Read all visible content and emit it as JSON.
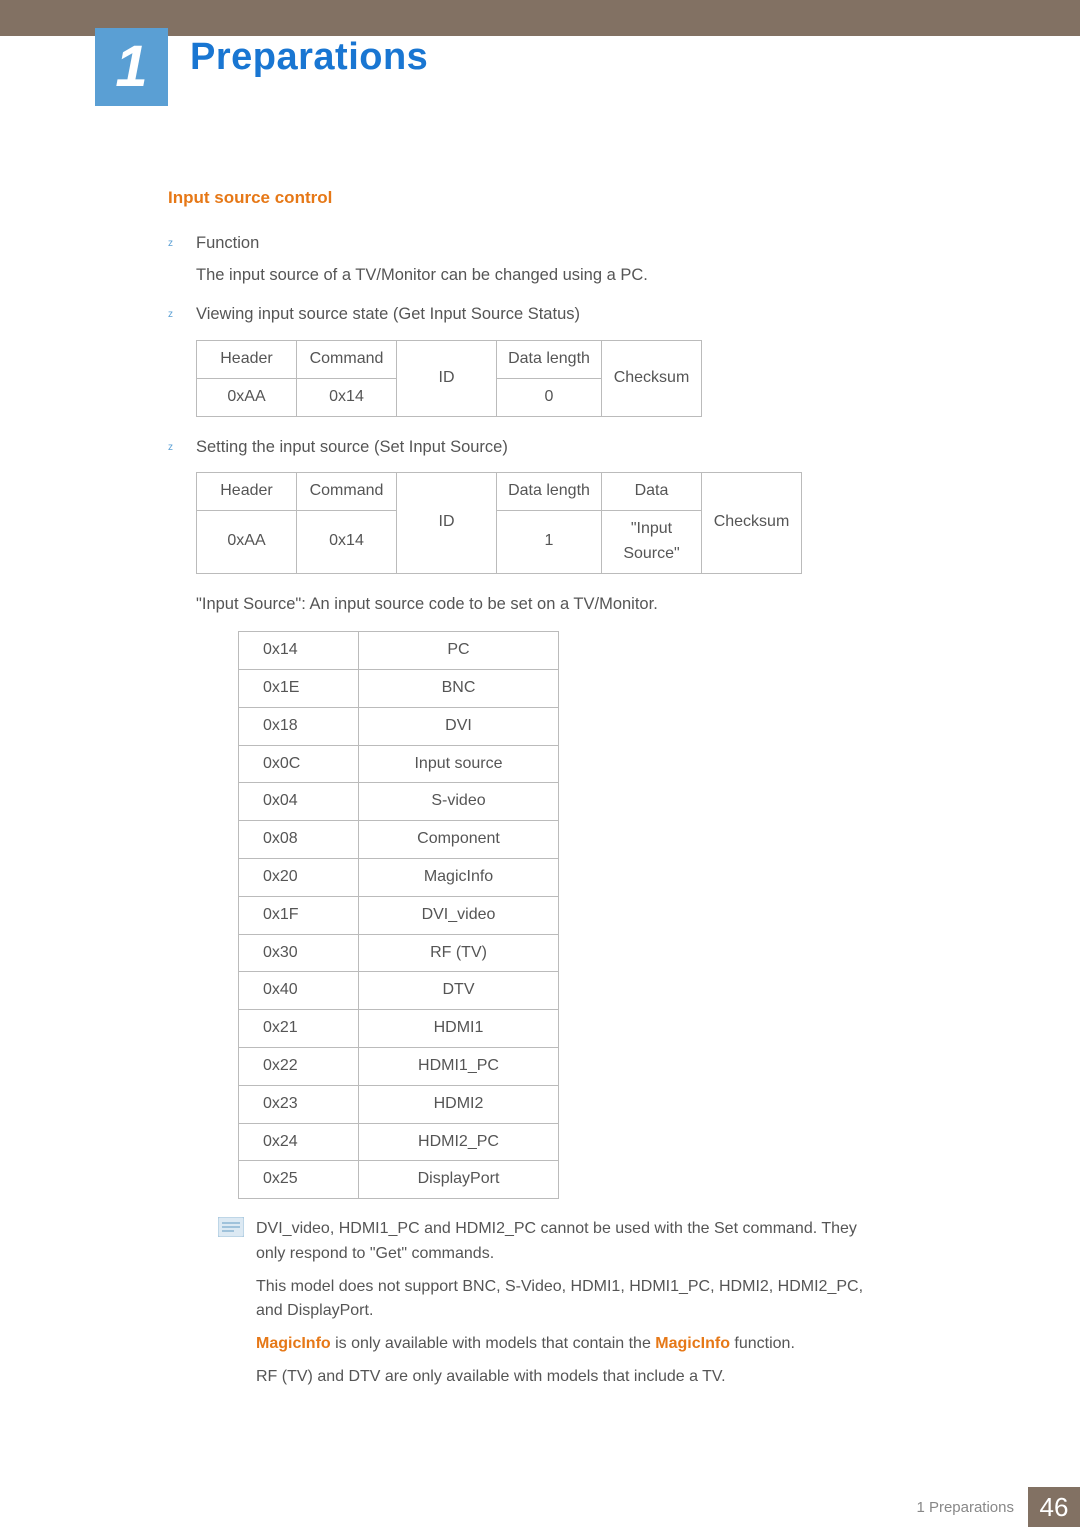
{
  "chapter": {
    "number": "1",
    "title": "Preparations"
  },
  "section": {
    "heading": "Input source control"
  },
  "bullets": {
    "b1_label": "Function",
    "b1_desc": "The input source of a TV/Monitor can be changed using a PC.",
    "b2": "Viewing input source state (Get Input Source Status)",
    "b3": "Setting the input source (Set Input Source)"
  },
  "table1": {
    "h0": "Header",
    "h1": "Command",
    "h2": "ID",
    "h3": "Data length",
    "h4": "Checksum",
    "r0": "0xAA",
    "r1": "0x14",
    "r3": "0"
  },
  "table2": {
    "h0": "Header",
    "h1": "Command",
    "h2": "ID",
    "h3": "Data length",
    "h4": "Data",
    "h5": "Checksum",
    "r0": "0xAA",
    "r1": "0x14",
    "r3": "1",
    "r4": "\"Input Source\""
  },
  "desc_line": "\"Input Source\": An input source code to be set on a TV/Monitor.",
  "sources": [
    {
      "code": "0x14",
      "name": "PC"
    },
    {
      "code": "0x1E",
      "name": "BNC"
    },
    {
      "code": "0x18",
      "name": "DVI"
    },
    {
      "code": "0x0C",
      "name": "Input source"
    },
    {
      "code": "0x04",
      "name": "S-video"
    },
    {
      "code": "0x08",
      "name": "Component"
    },
    {
      "code": "0x20",
      "name": "MagicInfo"
    },
    {
      "code": "0x1F",
      "name": "DVI_video"
    },
    {
      "code": "0x30",
      "name": "RF (TV)"
    },
    {
      "code": "0x40",
      "name": "DTV"
    },
    {
      "code": "0x21",
      "name": "HDMI1"
    },
    {
      "code": "0x22",
      "name": "HDMI1_PC"
    },
    {
      "code": "0x23",
      "name": "HDMI2"
    },
    {
      "code": "0x24",
      "name": "HDMI2_PC"
    },
    {
      "code": "0x25",
      "name": "DisplayPort"
    }
  ],
  "notes": {
    "n1": "DVI_video, HDMI1_PC and HDMI2_PC cannot be used with the Set command. They only respond to \"Get\" commands.",
    "n2": "This model does not support BNC, S-Video, HDMI1, HDMI1_PC, HDMI2, HDMI2_PC, and DisplayPort.",
    "n3_pre": "MagicInfo",
    "n3_mid": " is only available with models that contain the ",
    "n3_suf": " function.",
    "n4": "RF (TV) and DTV are only available with models that include a TV."
  },
  "footer": {
    "text": "1 Preparations",
    "page": "46"
  }
}
